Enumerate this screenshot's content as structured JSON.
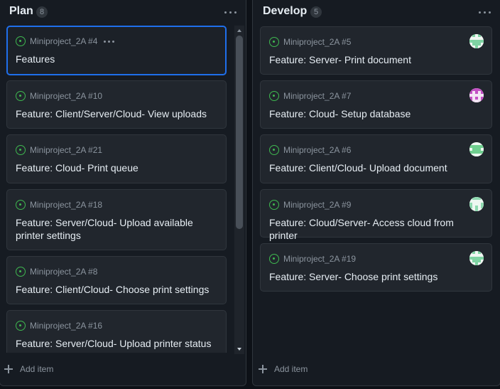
{
  "columns": [
    {
      "title": "Plan",
      "count": "8",
      "add_label": "Add item",
      "cards": [
        {
          "ref": "Miniproject_2A #4",
          "title": "Features"
        },
        {
          "ref": "Miniproject_2A #10",
          "title": "Feature: Client/Server/Cloud- View uploads"
        },
        {
          "ref": "Miniproject_2A #21",
          "title": "Feature: Cloud- Print queue"
        },
        {
          "ref": "Miniproject_2A #18",
          "title": "Feature: Server/Cloud- Upload available printer settings"
        },
        {
          "ref": "Miniproject_2A #8",
          "title": "Feature: Client/Cloud- Choose print settings"
        },
        {
          "ref": "Miniproject_2A #16",
          "title": "Feature: Server/Cloud- Upload printer status"
        }
      ]
    },
    {
      "title": "Develop",
      "count": "5",
      "add_label": "Add item",
      "cards": [
        {
          "ref": "Miniproject_2A #5",
          "title": "Feature: Server- Print document",
          "avatar_color": "#7fd3a3"
        },
        {
          "ref": "Miniproject_2A #7",
          "title": "Feature: Cloud- Setup database",
          "avatar_color": "#c34fc4"
        },
        {
          "ref": "Miniproject_2A #6",
          "title": "Feature: Client/Cloud- Upload document",
          "avatar_color": "#6fcf8f"
        },
        {
          "ref": "Miniproject_2A #9",
          "title": "Feature: Cloud/Server- Access cloud from printer",
          "avatar_color": "#8fd9b0"
        },
        {
          "ref": "Miniproject_2A #19",
          "title": "Feature: Server- Choose print settings",
          "avatar_color": "#7fd3a3"
        }
      ]
    }
  ],
  "icons": {
    "status": "issue-open-icon",
    "column_menu": "kebab-horizontal-icon",
    "card_menu": "kebab-horizontal-icon",
    "add": "plus-icon"
  },
  "colors": {
    "background": "#0d1117",
    "column": "#161b22",
    "card": "#21262d",
    "selected_border": "#1f6feb",
    "open_status": "#3fb950"
  }
}
